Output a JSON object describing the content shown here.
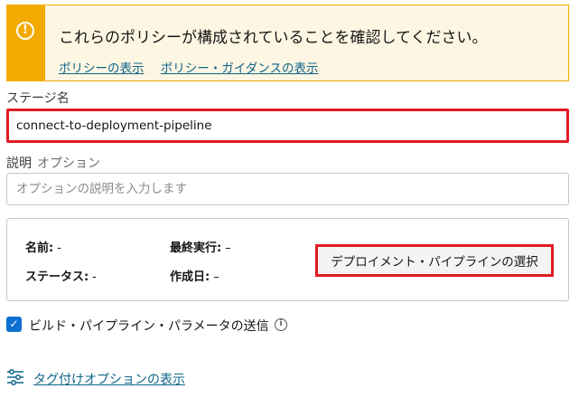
{
  "notice": {
    "title": "これらのポリシーが構成されていることを確認してください。",
    "links": [
      "ポリシーの表示",
      "ポリシー・ガイダンスの表示"
    ]
  },
  "stage_name": {
    "label": "ステージ名",
    "value": "connect-to-deployment-pipeline"
  },
  "description": {
    "label": "説明",
    "optional": "オプション",
    "placeholder": "オプションの説明を入力します"
  },
  "summary": {
    "name_label": "名前:",
    "name_value": "-",
    "status_label": "ステータス:",
    "status_value": "-",
    "last_run_label": "最終実行:",
    "last_run_value": "–",
    "created_label": "作成日:",
    "created_value": "–",
    "select_button": "デプロイメント・パイプラインの選択"
  },
  "send_params": {
    "label": "ビルド・パイプライン・パラメータの送信",
    "checked": true
  },
  "tags": {
    "link": "タグ付けオプションの表示"
  },
  "colors": {
    "warning": "#f2a900",
    "highlight": "#e01b24",
    "link": "#0d6589",
    "checkbox": "#0d6fd0"
  }
}
